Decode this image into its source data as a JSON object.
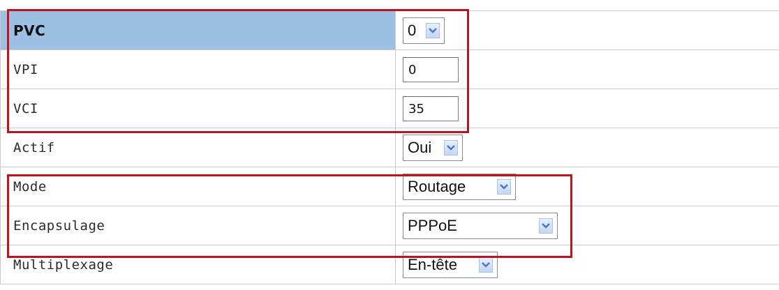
{
  "rows": [
    {
      "label": "PVC",
      "value": "0"
    },
    {
      "label": "VPI",
      "value": "0"
    },
    {
      "label": "VCI",
      "value": "35"
    },
    {
      "label": "Actif",
      "value": "Oui"
    },
    {
      "label": "Mode",
      "value": "Routage"
    },
    {
      "label": "Encapsulage",
      "value": "PPPoE"
    },
    {
      "label": "Multiplexage",
      "value": "En-tête"
    }
  ],
  "colors": {
    "header_bg": "#9dbfe3",
    "highlight": "#c0141c",
    "grid": "#c9c9c9"
  }
}
